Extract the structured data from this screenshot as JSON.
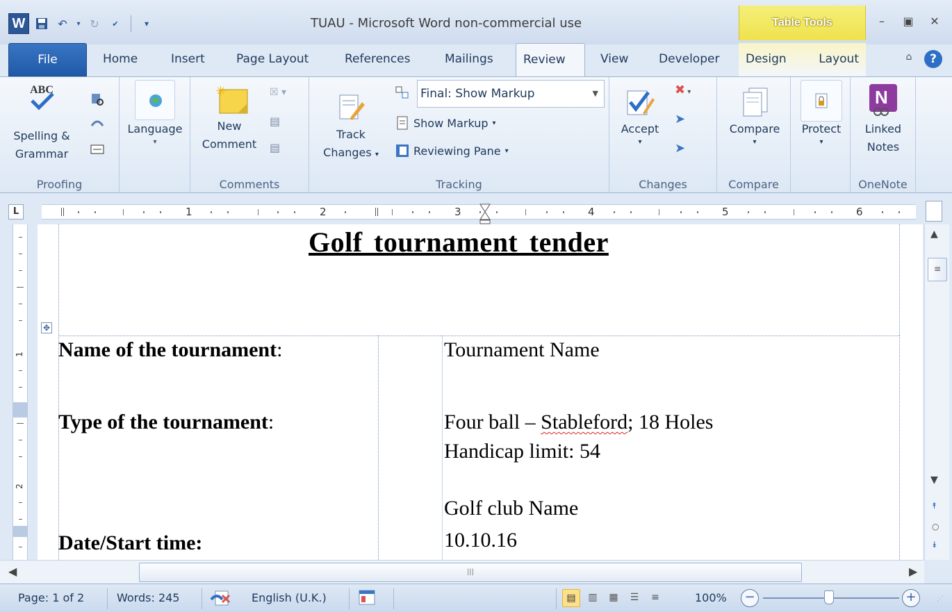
{
  "window": {
    "title": "TUAU  -  Microsoft Word non-commercial use",
    "context_tab_title": "Table Tools",
    "app_icon_letter": "W"
  },
  "tabs": [
    "File",
    "Home",
    "Insert",
    "Page Layout",
    "References",
    "Mailings",
    "Review",
    "View",
    "Developer",
    "Design",
    "Layout"
  ],
  "active_tab": "Review",
  "ribbon": {
    "proofing": {
      "spelling_line1": "Spelling &",
      "spelling_line2": "Grammar",
      "label": "Proofing",
      "abc": "ABC"
    },
    "language": {
      "button": "Language"
    },
    "comments": {
      "new_line1": "New",
      "new_line2": "Comment",
      "label": "Comments"
    },
    "tracking": {
      "track_line1": "Track",
      "track_line2": "Changes",
      "display_mode": "Final: Show Markup",
      "show_markup": "Show Markup",
      "reviewing_pane": "Reviewing Pane",
      "label": "Tracking"
    },
    "changes": {
      "accept": "Accept",
      "label": "Changes"
    },
    "compare": {
      "button": "Compare",
      "label": "Compare"
    },
    "protect": {
      "button": "Protect"
    },
    "onenote": {
      "line1": "Linked",
      "line2": "Notes",
      "label": "OneNote"
    }
  },
  "ruler": {
    "numbers": [
      "1",
      "2",
      "3",
      "4",
      "5",
      "6"
    ],
    "tab_selector": "L",
    "vertical_numbers": [
      "1",
      "2"
    ]
  },
  "document": {
    "title": "Golf tournament  tender",
    "rows": [
      {
        "label": "Name of the tournament",
        "colon": ":",
        "value_lines": [
          "Tournament Name"
        ]
      },
      {
        "label": "Type of the tournament",
        "colon": ":",
        "value_pre": "Four ball – ",
        "value_err": "Stableford",
        "value_post": "; 18 Holes",
        "value_line2": "Handicap limit: 54"
      },
      {
        "label": "Date/Start time:",
        "value_lines": [
          "Golf club Name",
          "10.10.16"
        ]
      }
    ]
  },
  "status": {
    "page": "Page: 1 of 2",
    "words": "Words: 245",
    "language": "English (U.K.)",
    "zoom": "100%",
    "zoom_level_percent": 100
  }
}
